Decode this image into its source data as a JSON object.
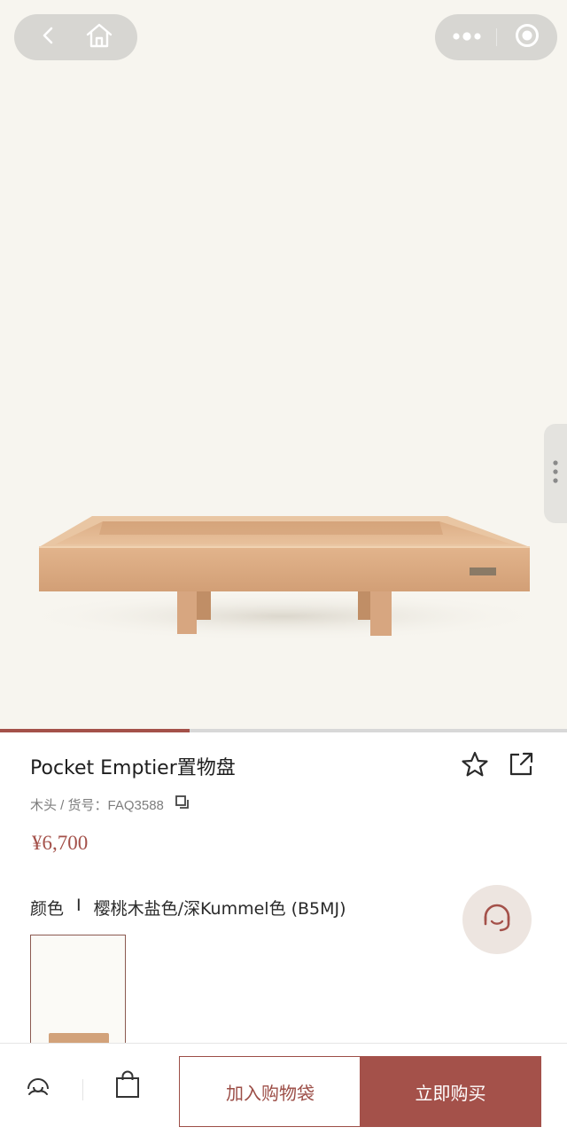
{
  "product": {
    "title": "Pocket Emptier置物盘",
    "meta": "木头 / 货号：FAQ3588",
    "price": "¥6,700",
    "color_label": "颜色",
    "color_separator": "I",
    "color_value": "樱桃木盐色/深Kummel色 (B5MJ)",
    "image_progress": 0.335
  },
  "capsule": {
    "left_icons": [
      "chevron-left-icon",
      "home-icon"
    ],
    "right_icons": [
      "more-icon",
      "target-icon"
    ]
  },
  "actions": {
    "favorite_icon": "star-icon",
    "share_icon": "share-icon",
    "copy_icon": "copy-icon",
    "service_icon": "headset-icon"
  },
  "bottom_bar": {
    "service_icon": "customer-service-icon",
    "bag_icon": "shopping-bag-icon",
    "add_to_bag": "加入购物袋",
    "buy_now": "立即购买"
  },
  "colors": {
    "accent": "#a4514a",
    "hero_bg": "#f7f5ef",
    "capsule_bg": "#d7d6d2"
  }
}
